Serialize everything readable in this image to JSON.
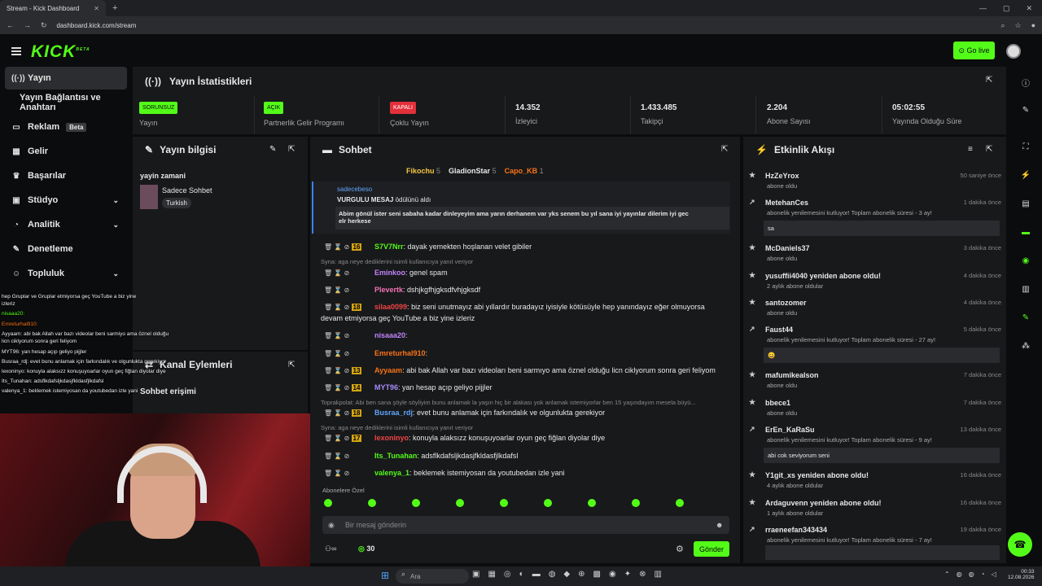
{
  "browser": {
    "tab_title": "Stream - Kick Dashboard",
    "url": "dashboard.kick.com/stream"
  },
  "header": {
    "logo": "KICK",
    "logo_sup": "BETA",
    "go_live": "Go live"
  },
  "sidebar": {
    "items": [
      {
        "label": "Yayın",
        "icon": "broadcast-icon"
      },
      {
        "label": "Yayın Bağlantısı ve Anahtarı",
        "icon": ""
      },
      {
        "label": "Reklam",
        "icon": "ad-icon",
        "badge": "Beta"
      },
      {
        "label": "Gelir",
        "icon": "chart-icon"
      },
      {
        "label": "Başarılar",
        "icon": "trophy-icon"
      },
      {
        "label": "Stüdyo",
        "icon": "studio-icon"
      },
      {
        "label": "Analitik",
        "icon": "analytics-icon"
      },
      {
        "label": "Denetleme",
        "icon": "wrench-icon"
      },
      {
        "label": "Topluluk",
        "icon": "community-icon"
      }
    ]
  },
  "stats": {
    "title": "Yayın İstatistikleri",
    "items": [
      {
        "pill": "SORUNSUZ",
        "label": "Yayın"
      },
      {
        "pill": "AÇIK",
        "label": "Partnerlik Gelir Programı"
      },
      {
        "pill": "KAPALI",
        "label": "Çoklu Yayın"
      },
      {
        "value": "14.352",
        "label": "İzleyici"
      },
      {
        "value": "1.433.485",
        "label": "Takipçi"
      },
      {
        "value": "2.204",
        "label": "Abone Sayısı"
      },
      {
        "value": "05:02:55",
        "label": "Yayında Olduğu Süre"
      }
    ]
  },
  "stream_info": {
    "title": "Yayın bilgisi",
    "stream_title": "yayin zamani",
    "category": "Sadece Sohbet",
    "tag": "Turkish"
  },
  "channel_actions": {
    "title": "Kanal Eylemleri",
    "item": "Sohbet erişimi"
  },
  "chat": {
    "title": "Sohbet",
    "top_gifters": [
      {
        "name": "Fikochu",
        "count": "5"
      },
      {
        "name": "GladionStar",
        "count": "5"
      },
      {
        "name": "Capo_KB",
        "count": "1"
      }
    ],
    "highlight": {
      "user": "sadecebeso",
      "reward": "VURGULU MESAJ",
      "reward_suffix": "ödülünü aldı",
      "text": "Abim gönül ister seni sabaha kadar dinleyeyim ama yarın derhanem var yks senem bu yıl sana iyi yayınlar dilerim iyi gec",
      "text2": "elr herkese"
    },
    "messages": [
      {
        "badge": "16",
        "user": "S7V7Nrr",
        "color": "#53fc18",
        "text": "dayak yemekten hoşlanan velet gibiler"
      },
      {
        "reply": "Syna: aga neye dediklerini isimli kullanıcıya yanıt veriyor"
      },
      {
        "badge": "",
        "user": "Eminkoo",
        "color": "#c084fc",
        "text": "genel spam"
      },
      {
        "badge": "",
        "user": "Plevertk",
        "color": "#f472b6",
        "text": "dshjkgfhjgksdfvhjgksdf"
      },
      {
        "badge": "18",
        "user": "silaa0099",
        "color": "#ef4444",
        "text": "biz seni unutmayız abi yıllardır buradayız iyisiyle kötüsüyle hep yanındayız eğer olmuyorsa"
      },
      {
        "cont": "devam etmiyorsa geç YouTube a biz yine izleriz"
      },
      {
        "badge": "",
        "user": "nisaaa20",
        "color": "#c084fc",
        "text": ""
      },
      {
        "badge": "",
        "user": "Emreturhal910",
        "color": "#f97316",
        "text": ""
      },
      {
        "badge": "13",
        "user": "Ayyaam",
        "color": "#f97316",
        "text": "abi bak Allah var bazı videoları beni sarmıyo ama öznel olduğu licn ciklyorum sonra geri feliyom"
      },
      {
        "badge": "14",
        "user": "MYT96",
        "color": "#a78bfa",
        "text": "yan hesap açıp geliyo pijjler"
      },
      {
        "reply": "Toprakpolat: Abi ben sana şöyle söyliyim bunu anlamak la yaşın hiç bir alakası yok anlamak istemiyorlar ben 15 yaşındayım mesela büyü..."
      },
      {
        "badge": "18",
        "user": "Busraa_rdj",
        "color": "#60a5fa",
        "text": "evet bunu anlamak için farkındalık ve olgunlukta gerekiyor"
      },
      {
        "reply": "Syna: aga neye dediklerini isimli kullanıcıya yanıt veriyor"
      },
      {
        "badge": "17",
        "user": "lexoninyo",
        "color": "#ef4444",
        "text": "konuyla alaksızz konuşuyoarlar oyun geç fiğlan diyolar diye"
      },
      {
        "badge": "",
        "user": "Its_Tunahan",
        "color": "#53fc18",
        "text": "adsflkdafsljkdasjfkldasfjlkdafsl"
      },
      {
        "badge": "",
        "user": "valenya_1",
        "color": "#53fc18",
        "text": "beklemek istemiyosan da youtubedan izle yani"
      }
    ],
    "emotes_label": "Abonelere Özel",
    "input_placeholder": "Bir mesaj gönderin",
    "points": "30",
    "send": "Gönder"
  },
  "activity": {
    "title": "Etkinlik Akışı",
    "items": [
      {
        "user": "HzZeYrox",
        "sub": "abone oldu",
        "time": "50 saniye önce"
      },
      {
        "user": "MetehanCes",
        "sub": "abonelik yenilemesini kutluyor! Toplam abonelik süresi - 3 ay!",
        "time": "1 dakika önce",
        "note": "sa"
      },
      {
        "user": "McDaniels37",
        "sub": "abone oldu",
        "time": "3 dakika önce"
      },
      {
        "user": "yusuffii4040 yeniden abone oldu!",
        "sub": "2 aylık abone oldular",
        "time": "4 dakika önce"
      },
      {
        "user": "santozomer",
        "sub": "abone oldu",
        "time": "4 dakika önce"
      },
      {
        "user": "Faust44",
        "sub": "abonelik yenilemesini kutluyor! Toplam abonelik süresi - 27 ay!",
        "time": "5 dakika önce",
        "note": "😄"
      },
      {
        "user": "mafumikealson",
        "sub": "abone oldu",
        "time": "7 dakika önce"
      },
      {
        "user": "bbece1",
        "sub": "abone oldu",
        "time": "7 dakika önce"
      },
      {
        "user": "ErEn_KaRaSu",
        "sub": "abonelik yenilemesini kutluyor! Toplam abonelik süresi - 9 ay!",
        "time": "13 dakika önce",
        "note": "abi cok seviyorum seni"
      },
      {
        "user": "Y1git_xs yeniden abone oldu!",
        "sub": "4 aylık abone oldular",
        "time": "16 dakika önce"
      },
      {
        "user": "Ardaguvenn yeniden abone oldu!",
        "sub": "1 aylık abone oldular",
        "time": "16 dakika önce"
      },
      {
        "user": "rraeneefan343434",
        "sub": "abonelik yenilemesini kutluyor! Toplam abonelik süresi - 7 ay!",
        "time": "19 dakika önce"
      }
    ]
  },
  "overlay_chat": [
    "hep Gruplar ve Gruplar etmiyorsa geç YouTube a biz yine",
    "izleriz",
    "nisaaa20:",
    "Emreturhal910:",
    "Ayyaam: abi bak Allah var bazı videolar beni sarmiyo ama öznel olduğu",
    "licn ciklyorum sonra geri feliyom",
    "MYT96: yan hesap açıp geliyo pijjler",
    "Busraa_rdj: evet bunu anlamak için farkındalık ve olgunlukta gerekiyor",
    "lexoninyo: konuyla alaksızz konuşuyoarlar oyun geç fiğlan diyolar diye",
    "Its_Tunahan: adsflkdafsljkdasjfkldasfjlkdafsl",
    "valenya_1: beklemek istemiyosan da youtubedan izle yani"
  ],
  "taskbar": {
    "search": "Ara",
    "time": "00:33",
    "date": "12.08.2026"
  },
  "colors": {
    "accent": "#53fc18",
    "danger": "#e2303a",
    "panel": "#18191b"
  }
}
